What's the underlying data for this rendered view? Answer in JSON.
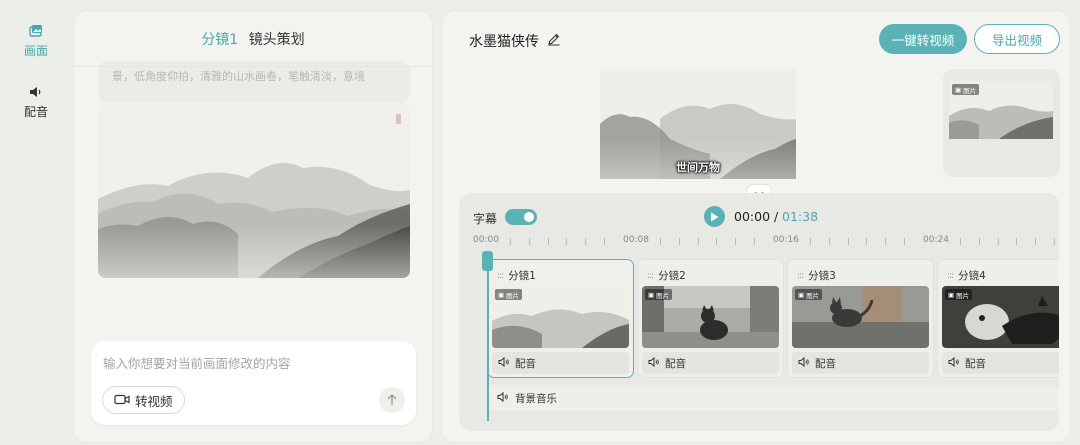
{
  "rail": {
    "items": [
      {
        "label": "画面",
        "icon": "image-icon",
        "active": true
      },
      {
        "label": "配音",
        "icon": "speaker-icon",
        "active": false
      }
    ]
  },
  "storyboard": {
    "title_accent": "分镜1",
    "title": "镜头策划",
    "prompt_text": "景，低角度仰拍，清雅的山水画卷，笔触清淡，意境"
  },
  "chat": {
    "placeholder": "输入你想要对当前画面修改的内容",
    "to_video_label": "转视频"
  },
  "project": {
    "title": "水墨猫侠传",
    "one_click_label": "一键转视频",
    "export_label": "导出视频"
  },
  "preview": {
    "subtitle": "世间万物"
  },
  "timeline": {
    "subtitle_label": "字幕",
    "subtitle_on": true,
    "current_time": "00:00",
    "separator": "/",
    "total_time": "01:38",
    "ruler_labels": [
      "00:00",
      "00:08",
      "00:16",
      "00:24"
    ],
    "clips": [
      {
        "name": "分镜1",
        "badge": "图片",
        "audio": "配音",
        "selected": true
      },
      {
        "name": "分镜2",
        "badge": "图片",
        "audio": "配音",
        "selected": false
      },
      {
        "name": "分镜3",
        "badge": "图片",
        "audio": "配音",
        "selected": false
      },
      {
        "name": "分镜4",
        "badge": "图片",
        "audio": "配音",
        "selected": false
      }
    ],
    "bgm_label": "背景音乐"
  },
  "colors": {
    "accent": "#5bb2b6",
    "accent_text": "#4aa7ad",
    "panel": "#f3f4f0",
    "background": "#eceee9"
  }
}
